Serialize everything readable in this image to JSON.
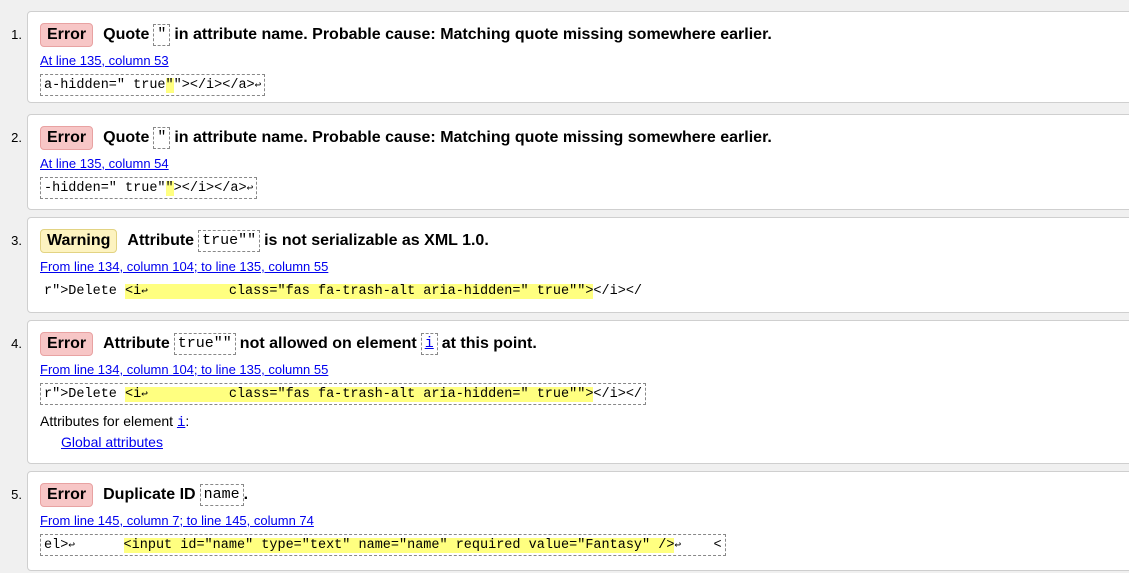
{
  "messages": [
    {
      "number": "1.",
      "type": "Error",
      "title_pre": "Quote",
      "title_code": "\"",
      "title_post": "in attribute name. Probable cause: Matching quote missing somewhere earlier.",
      "location": "At line 135, column 53",
      "extract_pre": "a-hidden=\" true",
      "extract_hl": "\"",
      "extract_post": "\"></i></a>",
      "return_glyph": "↩"
    },
    {
      "number": "2.",
      "type": "Error",
      "title_pre": "Quote",
      "title_code": "\"",
      "title_post": "in attribute name. Probable cause: Matching quote missing somewhere earlier.",
      "location": "At line 135, column 54",
      "extract_pre": "-hidden=\" true\"",
      "extract_hl": "\"",
      "extract_post": "></i></a>",
      "return_glyph": "↩"
    },
    {
      "number": "3.",
      "type": "Warning",
      "title_pre": "Attribute",
      "title_code": "true\"\"",
      "title_post": "is not serializable as XML 1.0.",
      "location": "From line 134, column 104; to line 135, column 55",
      "extract_pre": "r\">Delete ",
      "extract_hl_1": "<i",
      "extract_hl_2": "          class=\"fas fa-trash-alt aria-hidden=\" true\"\">",
      "extract_post": "</i></",
      "return_glyph": "↩"
    },
    {
      "number": "4.",
      "type": "Error",
      "title_pre": "Attribute",
      "title_code": "true\"\"",
      "title_mid": "not allowed on element",
      "title_code2": "i",
      "title_post": "at this point.",
      "location": "From line 134, column 104; to line 135, column 55",
      "extract_pre": "r\">Delete ",
      "extract_hl_1": "<i",
      "extract_hl_2": "          class=\"fas fa-trash-alt aria-hidden=\" true\"\">",
      "extract_post": "</i></",
      "return_glyph": "↩",
      "attributes_for": "Attributes for element",
      "attributes_el": "i",
      "attributes_colon": ":",
      "global_attributes": "Global attributes"
    },
    {
      "number": "5.",
      "type": "Error",
      "title_pre": "Duplicate ID",
      "title_code": "name",
      "title_post": ".",
      "location": "From line 145, column 7; to line 145, column 74",
      "extract_pre": "el>",
      "extract_gap": "      ",
      "extract_hl": "<input id=\"name\" type=\"text\" name=\"name\" required value=\"Fantasy\" />",
      "extract_post": "    <",
      "return_glyph": "↩"
    }
  ],
  "colors": {
    "error_badge": "#f7c6c6",
    "warning_badge": "#fdf3c0",
    "highlight": "#ffff80",
    "link": "#0000ee"
  }
}
